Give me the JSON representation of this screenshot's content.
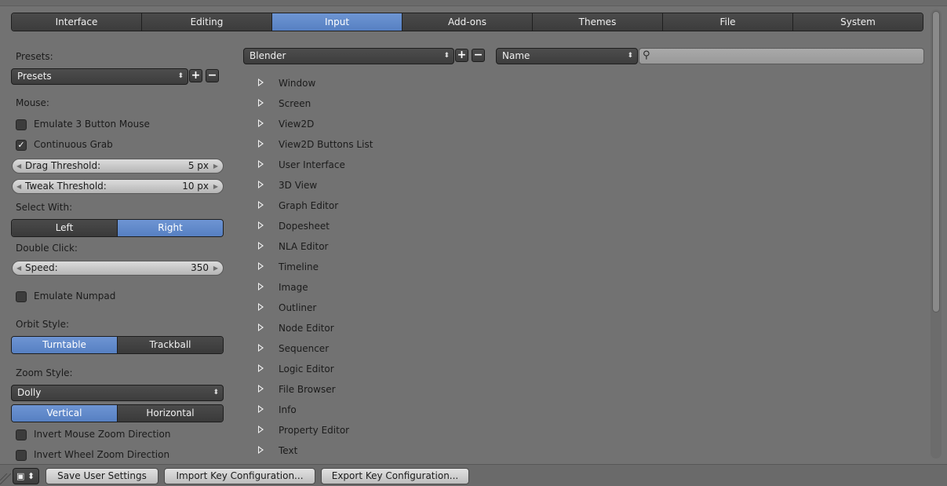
{
  "tabs": [
    {
      "label": "Interface"
    },
    {
      "label": "Editing"
    },
    {
      "label": "Input",
      "active": true
    },
    {
      "label": "Add-ons"
    },
    {
      "label": "Themes"
    },
    {
      "label": "File"
    },
    {
      "label": "System"
    }
  ],
  "left": {
    "presets_heading": "Presets:",
    "presets_value": "Presets",
    "mouse_heading": "Mouse:",
    "emulate_3_button": {
      "label": "Emulate 3 Button Mouse",
      "checked": false
    },
    "continuous_grab": {
      "label": "Continuous Grab",
      "checked": true
    },
    "drag_threshold": {
      "label": "Drag Threshold:",
      "value": "5 px"
    },
    "tweak_threshold": {
      "label": "Tweak Threshold:",
      "value": "10 px"
    },
    "select_with_heading": "Select With:",
    "select_with": {
      "left": "Left",
      "right": "Right",
      "selected": "Right"
    },
    "double_click_heading": "Double Click:",
    "speed": {
      "label": "Speed:",
      "value": "350"
    },
    "emulate_numpad": {
      "label": "Emulate Numpad",
      "checked": false
    },
    "orbit_style_heading": "Orbit Style:",
    "orbit_style": {
      "a": "Turntable",
      "b": "Trackball",
      "selected": "Turntable"
    },
    "zoom_style_heading": "Zoom Style:",
    "zoom_style_value": "Dolly",
    "zoom_axis": {
      "a": "Vertical",
      "b": "Horizontal",
      "selected": "Vertical"
    },
    "invert_mouse_zoom": {
      "label": "Invert Mouse Zoom Direction",
      "checked": false
    },
    "invert_wheel_zoom": {
      "label": "Invert Wheel Zoom Direction",
      "checked": false
    }
  },
  "right": {
    "keyconfig_value": "Blender",
    "filter_type_value": "Name",
    "search_value": "",
    "keymap_items": [
      "Window",
      "Screen",
      "View2D",
      "View2D Buttons List",
      "User Interface",
      "3D View",
      "Graph Editor",
      "Dopesheet",
      "NLA Editor",
      "Timeline",
      "Image",
      "Outliner",
      "Node Editor",
      "Sequencer",
      "Logic Editor",
      "File Browser",
      "Info",
      "Property Editor",
      "Text"
    ]
  },
  "bottom": {
    "save_user_settings": "Save User Settings",
    "import_key_config": "Import Key Configuration...",
    "export_key_config": "Export Key Configuration..."
  },
  "icons": {
    "plus": "+",
    "minus": "−",
    "updown": "⬍",
    "search": "⚲"
  },
  "colors": {
    "accent": "#5a84c8",
    "background": "#727272"
  }
}
